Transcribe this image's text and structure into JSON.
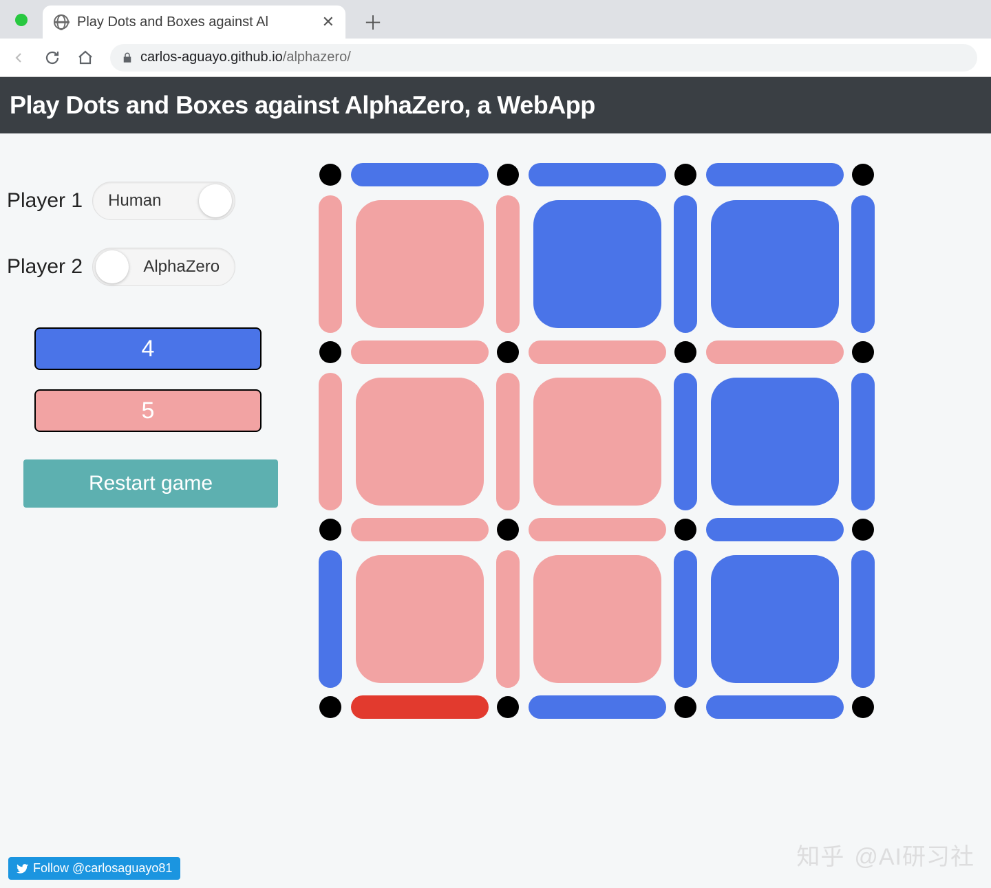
{
  "browser": {
    "tab_title": "Play Dots and Boxes against Al",
    "url_host": "carlos-aguayo.github.io",
    "url_path": "/alphazero/"
  },
  "header": {
    "title": "Play Dots and Boxes against AlphaZero, a WebApp"
  },
  "sidebar": {
    "player1_label": "Player 1",
    "player1_value": "Human",
    "player1_side": "right",
    "player2_label": "Player 2",
    "player2_value": "AlphaZero",
    "player2_side": "left",
    "score_blue": "4",
    "score_pink": "5",
    "restart_label": "Restart game"
  },
  "board": {
    "size": 3,
    "colors": {
      "blue": "#4a74e8",
      "pink": "#f2a3a3",
      "red": "#e23a2e"
    },
    "h_edges": [
      [
        "blue",
        "blue",
        "blue"
      ],
      [
        "pink",
        "pink",
        "pink"
      ],
      [
        "pink",
        "pink",
        "blue"
      ],
      [
        "red",
        "blue",
        "blue"
      ]
    ],
    "v_edges": [
      [
        "pink",
        "pink",
        "blue",
        "blue"
      ],
      [
        "pink",
        "pink",
        "blue",
        "blue"
      ],
      [
        "blue",
        "pink",
        "blue",
        "blue"
      ]
    ],
    "boxes": [
      [
        "pink",
        "blue",
        "blue"
      ],
      [
        "pink",
        "pink",
        "blue"
      ],
      [
        "pink",
        "pink",
        "blue"
      ]
    ]
  },
  "twitter": {
    "text": "Follow @carlosaguayo81"
  },
  "watermark": {
    "brand": "知乎",
    "author": "@AI研习社"
  }
}
